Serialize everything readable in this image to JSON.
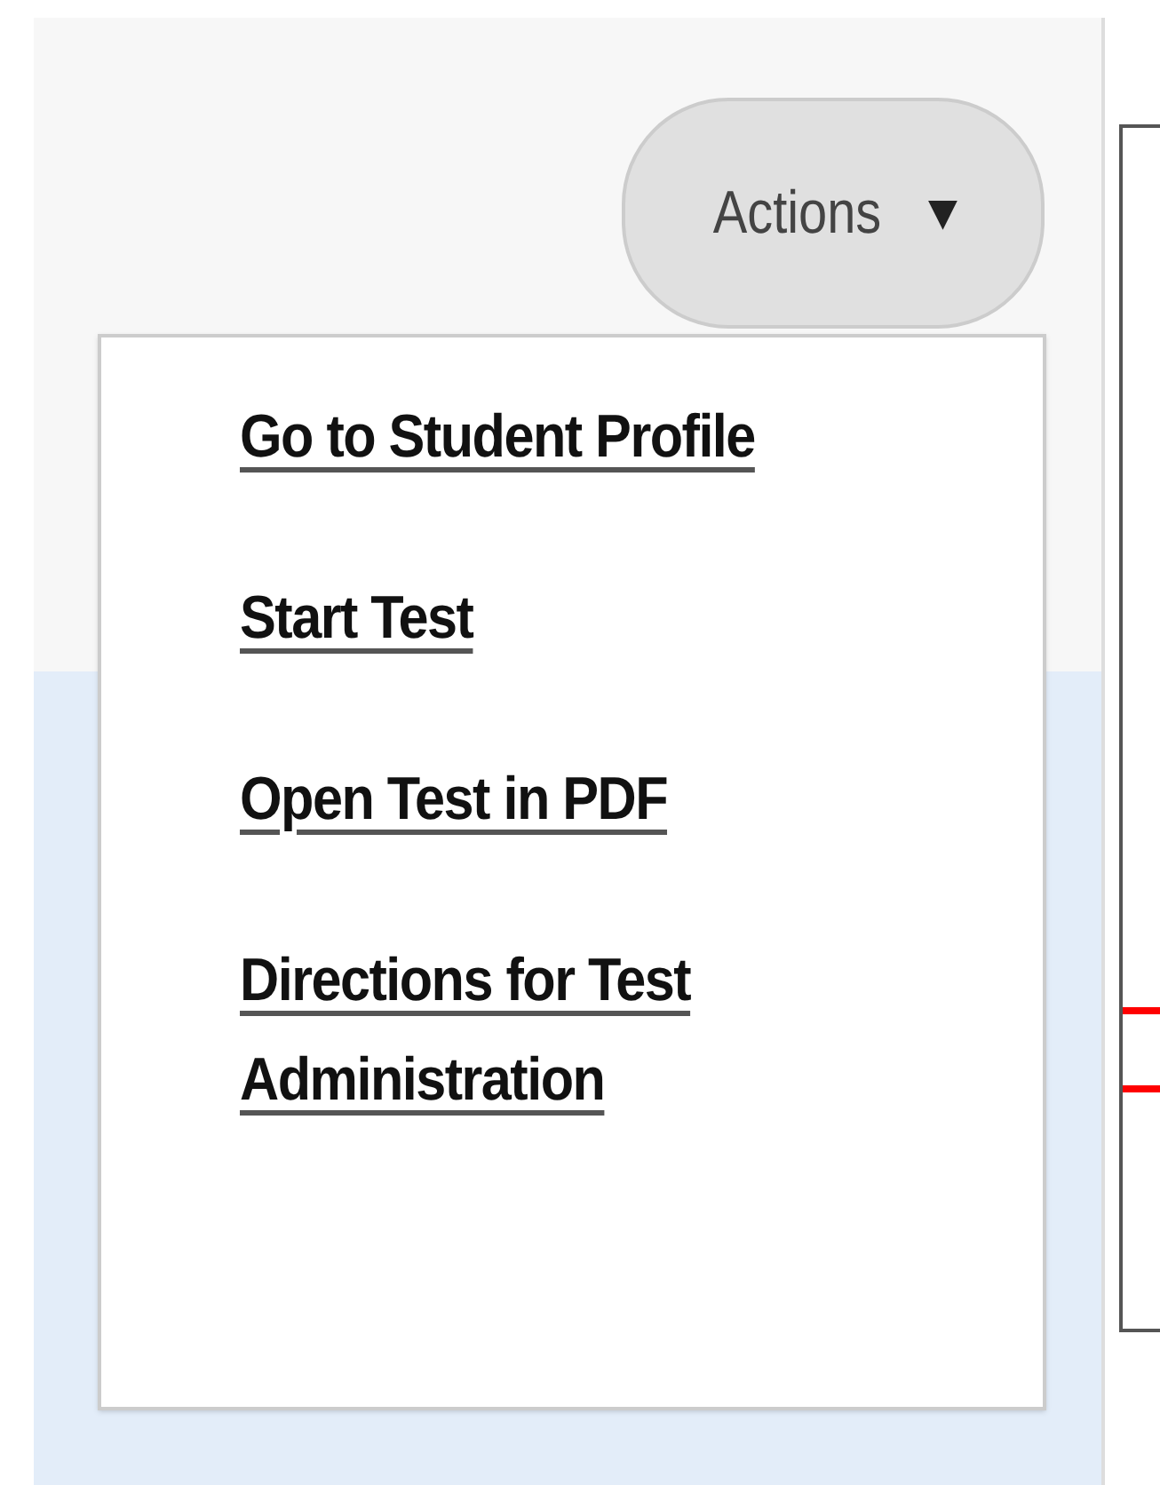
{
  "actions_button": {
    "label": "Actions",
    "caret": "▼",
    "expanded": true
  },
  "menu_items": [
    {
      "label": "Go to Student Profile"
    },
    {
      "label": "Start Test"
    },
    {
      "label": "Open Test in PDF"
    },
    {
      "label": "Directions for Test Administration"
    }
  ]
}
